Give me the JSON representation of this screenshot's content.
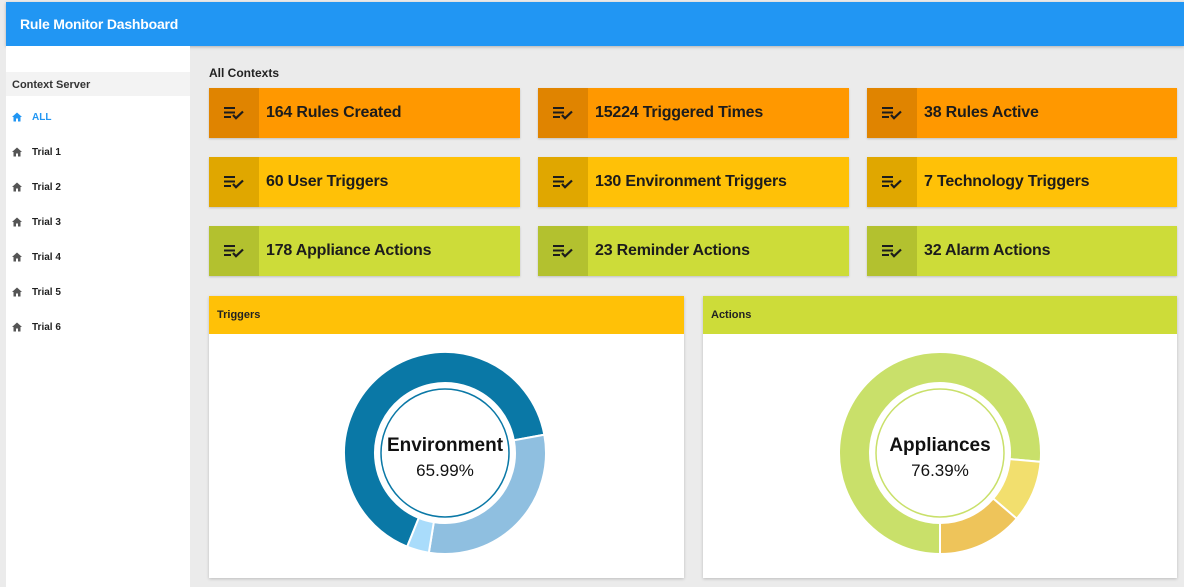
{
  "app": {
    "title": "Rule Monitor Dashboard"
  },
  "sidebar": {
    "header": "Context Server",
    "items": [
      {
        "label": "ALL",
        "active": true
      },
      {
        "label": "Trial 1",
        "active": false
      },
      {
        "label": "Trial 2",
        "active": false
      },
      {
        "label": "Trial 3",
        "active": false
      },
      {
        "label": "Trial 4",
        "active": false
      },
      {
        "label": "Trial 5",
        "active": false
      },
      {
        "label": "Trial 6",
        "active": false
      }
    ]
  },
  "main": {
    "title": "All Contexts",
    "cards": [
      {
        "label": "164 Rules Created",
        "color": "orange"
      },
      {
        "label": "15224 Triggered Times",
        "color": "orange"
      },
      {
        "label": "38 Rules Active",
        "color": "orange"
      },
      {
        "label": "60 User Triggers",
        "color": "amber"
      },
      {
        "label": "130 Environment Triggers",
        "color": "amber"
      },
      {
        "label": "7 Technology Triggers",
        "color": "amber"
      },
      {
        "label": "178 Appliance Actions",
        "color": "lime"
      },
      {
        "label": "23 Reminder Actions",
        "color": "lime"
      },
      {
        "label": "32 Alarm Actions",
        "color": "lime"
      }
    ]
  },
  "colors": {
    "topbar": "#2196f3",
    "active_item": "#2196f3",
    "orange": "#ff9800",
    "amber": "#ffc107",
    "lime": "#cddc39"
  },
  "icons": {
    "card": "playlist-check-icon",
    "nav": "home-icon"
  },
  "chart_data": [
    {
      "type": "pie",
      "panel_title": "Triggers",
      "center_label": "Environment",
      "center_value": "65.99%",
      "slices": [
        {
          "value": 130,
          "color": "#0a78a6"
        },
        {
          "value": 60,
          "color": "#8fbfe0"
        },
        {
          "value": 7,
          "color": "#a9dcfb"
        }
      ]
    },
    {
      "type": "pie",
      "panel_title": "Actions",
      "center_label": "Appliances",
      "center_value": "76.39%",
      "slices": [
        {
          "value": 178,
          "color": "#c9e06a"
        },
        {
          "value": 23,
          "color": "#f2df6e"
        },
        {
          "value": 32,
          "color": "#eec45a"
        }
      ]
    }
  ]
}
